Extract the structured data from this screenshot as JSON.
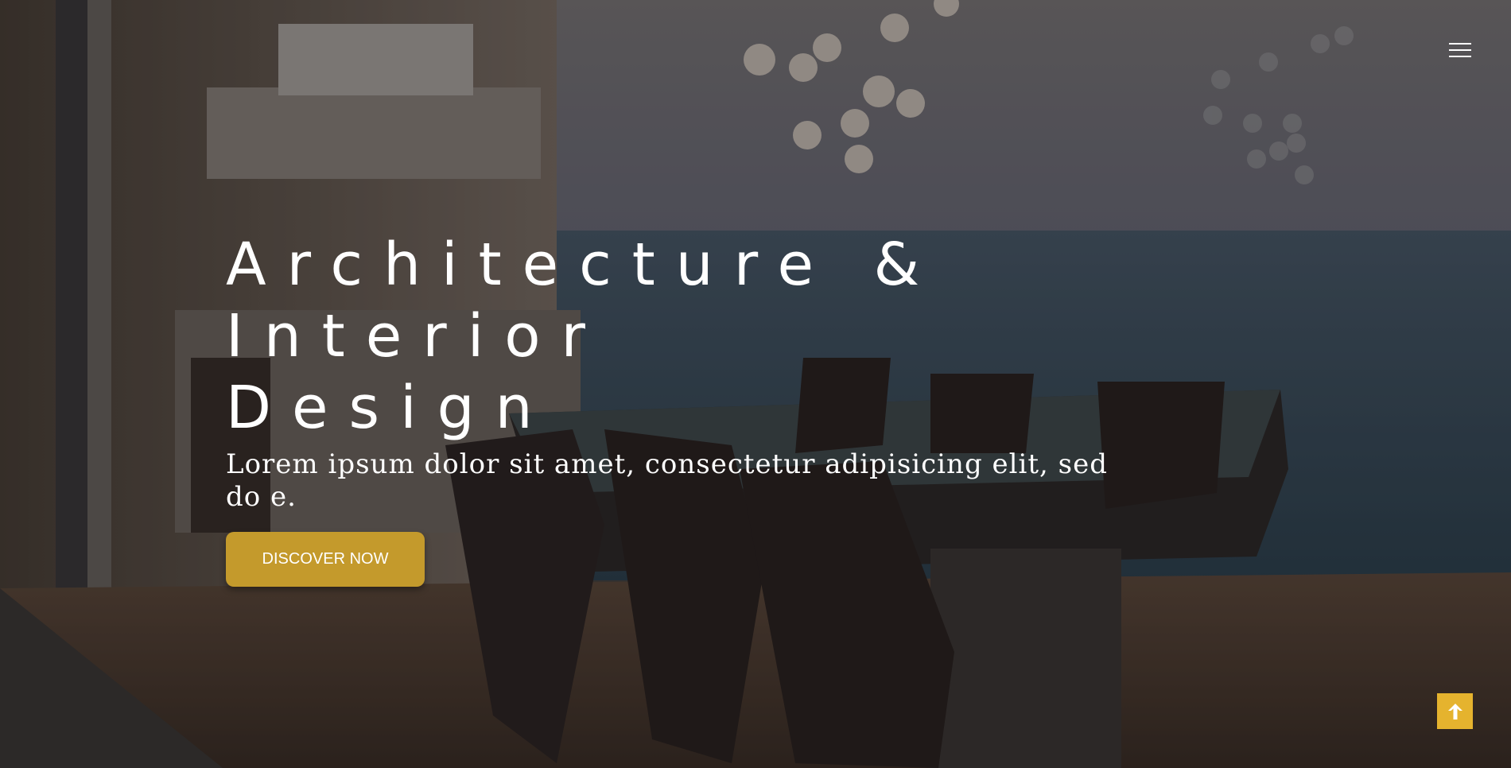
{
  "hero": {
    "title_lines": [
      "Architecture &",
      "Interior",
      "Design"
    ],
    "subtitle": "Lorem ipsum dolor sit amet, consectetur adipisicing elit, sed do e.",
    "cta_label": "DISCOVER NOW"
  },
  "nav": {
    "menu_icon": "hamburger-menu-icon"
  },
  "back_to_top": {
    "icon": "arrow-up-icon"
  },
  "colors": {
    "accent": "#c49a2c",
    "back_to_top_bg": "#e5b32e",
    "text": "#ffffff"
  }
}
